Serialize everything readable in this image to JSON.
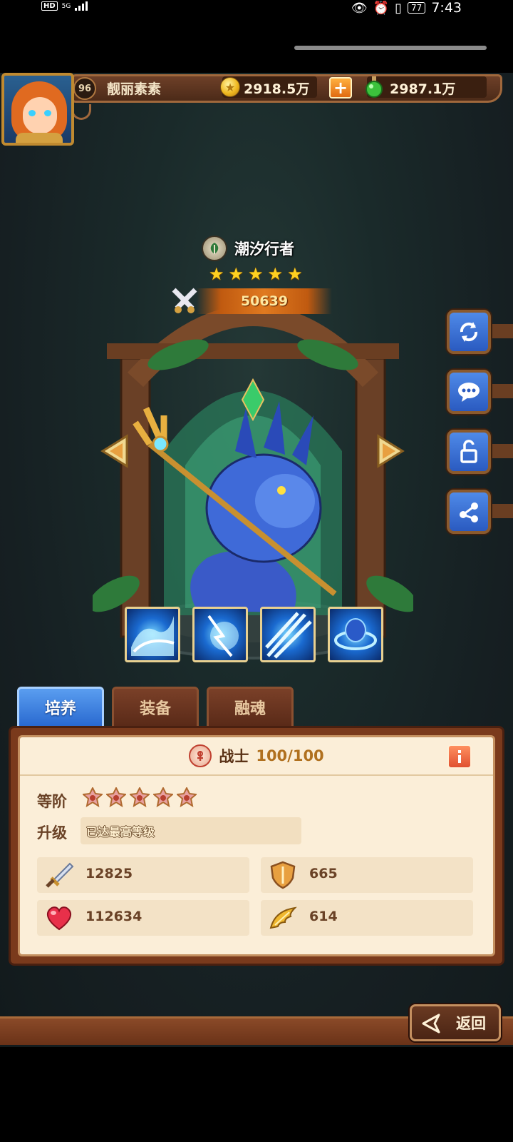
{
  "status_bar": {
    "hd": "HD",
    "network": "5G",
    "battery": "77",
    "time": "7:43"
  },
  "player": {
    "level": "96",
    "name": "靓丽素素",
    "gold": "2918.5万",
    "potion": "2987.1万"
  },
  "hero": {
    "name": "潮汐行者",
    "stars": 5,
    "power": "50639"
  },
  "side_buttons": [
    "refresh-icon",
    "chat-icon",
    "unlock-icon",
    "share-icon"
  ],
  "skills": [
    "water-skill-1",
    "water-skill-2",
    "water-skill-3",
    "water-skill-4"
  ],
  "tabs": [
    {
      "label": "培养",
      "active": true
    },
    {
      "label": "装备",
      "active": false
    },
    {
      "label": "融魂",
      "active": false
    }
  ],
  "panel": {
    "class_name": "战士",
    "class_level": "100/100",
    "rank_label": "等阶",
    "rank_stars": 5,
    "upgrade_label": "升级",
    "upgrade_status": "已达最高等级",
    "stats": {
      "attack": "12825",
      "defense": "665",
      "hp": "112634",
      "speed": "614"
    }
  },
  "back_button": {
    "label": "返回"
  },
  "colors": {
    "panel_bg": "#fbeed8",
    "frame_brown": "#7a3a1c",
    "tab_active": "#2a6ad0",
    "star_gold": "#ffd020",
    "power_orange": "#e07a20"
  }
}
